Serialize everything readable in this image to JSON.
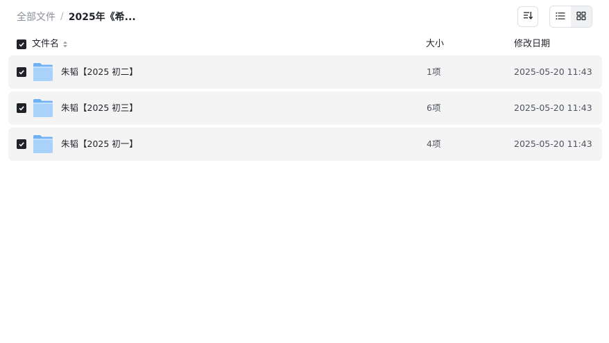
{
  "breadcrumb": {
    "root": "全部文件",
    "separator": "/",
    "current": "2025年《希..."
  },
  "toolbar": {
    "sort_icon": "sort-descending-icon",
    "list_view_icon": "list-view-icon",
    "grid_view_icon": "grid-view-icon",
    "active_view": "list"
  },
  "table": {
    "columns": {
      "name": "文件名",
      "size": "大小",
      "modified": "修改日期"
    },
    "select_all_checked": true,
    "rows": [
      {
        "name": "朱韬【2025 初二】",
        "size": "1项",
        "modified": "2025-05-20 11:43",
        "checked": true,
        "icon": "folder-icon"
      },
      {
        "name": "朱韬【2025 初三】",
        "size": "6项",
        "modified": "2025-05-20 11:43",
        "checked": true,
        "icon": "folder-icon"
      },
      {
        "name": "朱韬【2025 初一】",
        "size": "4项",
        "modified": "2025-05-20 11:43",
        "checked": true,
        "icon": "folder-icon"
      }
    ]
  },
  "colors": {
    "row_background": "#f4f4f5",
    "checkbox": "#1f2329",
    "folder_light": "#a9d2fb",
    "folder_dark": "#6fb1f2"
  }
}
